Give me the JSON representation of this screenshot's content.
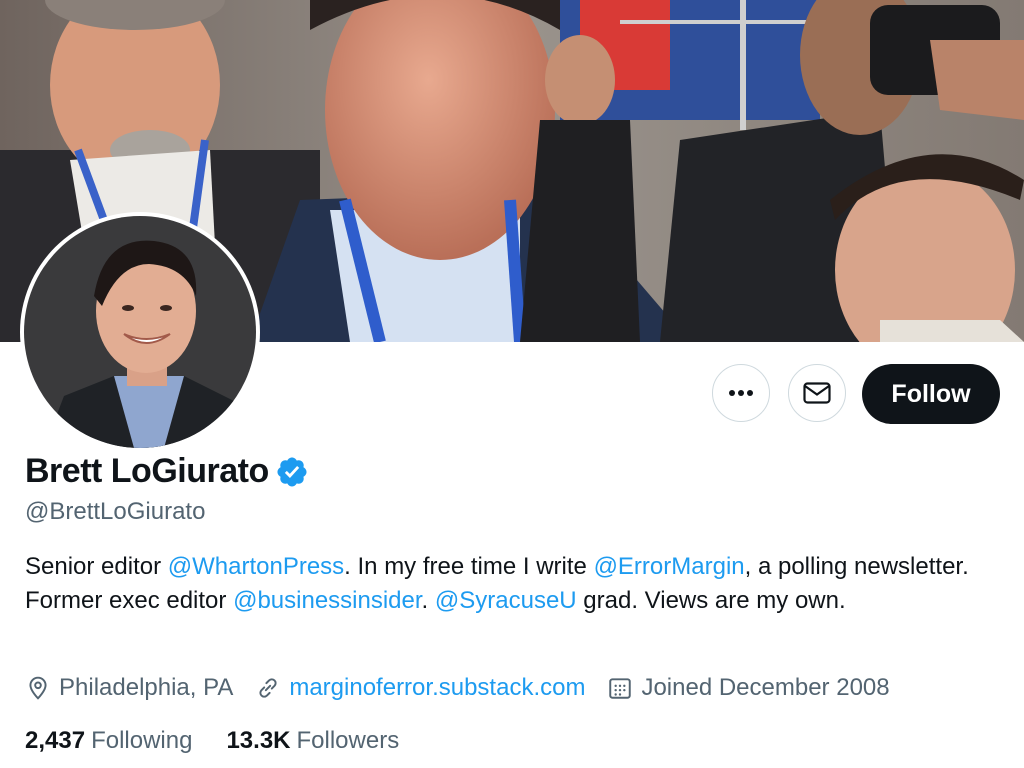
{
  "profile": {
    "display_name": "Brett LoGiurato",
    "handle": "@BrettLoGiurato",
    "verified_icon": "verified-badge-icon",
    "bio": {
      "part1": "Senior editor ",
      "mention1": "@WhartonPress",
      "part2": ". In my free time I write ",
      "mention2": "@ErrorMargin",
      "part3": ", a polling newsletter. Former exec editor ",
      "mention3": "@businessinsider",
      "part4": ". ",
      "mention4": "@SyracuseU",
      "part5": " grad. Views are my own."
    },
    "location": "Philadelphia, PA",
    "website": "marginoferror.substack.com",
    "joined": "Joined December 2008",
    "following_count": "2,437",
    "following_label": "Following",
    "followers_count": "13.3K",
    "followers_label": "Followers"
  },
  "actions": {
    "more_icon": "more-horizontal-icon",
    "message_icon": "envelope-icon",
    "follow_label": "Follow"
  },
  "colors": {
    "accent": "#1d9bf0",
    "primary_text": "#0f1419",
    "secondary_text": "#536471",
    "follow_button_bg": "#0f1419"
  }
}
